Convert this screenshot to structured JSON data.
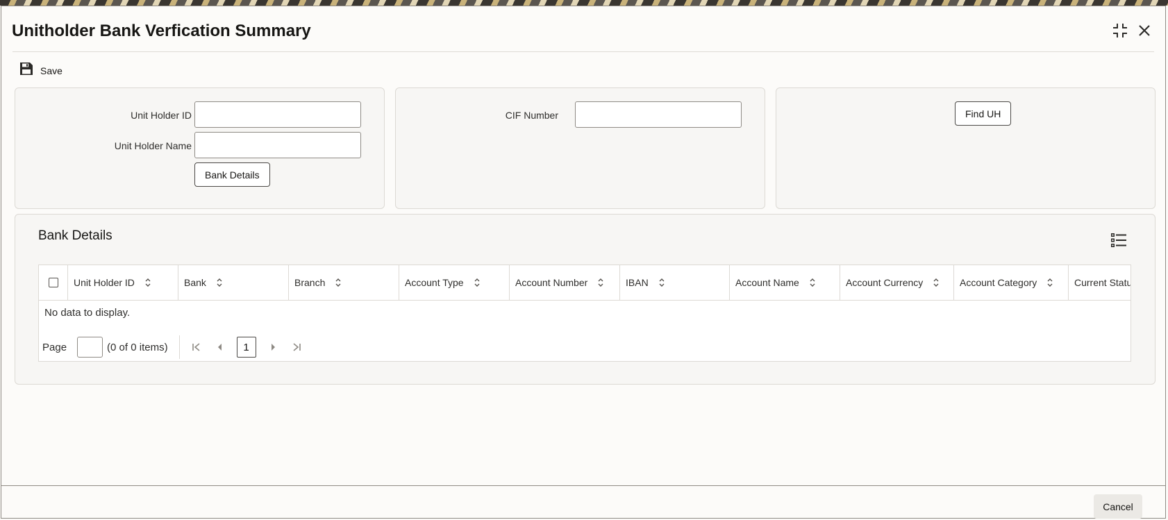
{
  "window": {
    "title": "Unitholder Bank Verfication Summary"
  },
  "toolbar": {
    "save_label": "Save"
  },
  "search": {
    "unit_holder_id_label": "Unit Holder ID",
    "unit_holder_id_value": "",
    "unit_holder_name_label": "Unit Holder Name",
    "unit_holder_name_value": "",
    "bank_details_button": "Bank Details",
    "cif_number_label": "CIF Number",
    "cif_number_value": "",
    "find_uh_button": "Find UH"
  },
  "bank_details": {
    "title": "Bank Details",
    "columns": [
      "Unit Holder ID",
      "Bank",
      "Branch",
      "Account Type",
      "Account Number",
      "IBAN",
      "Account Name",
      "Account Currency",
      "Account Category",
      "Current Status"
    ],
    "empty_text": "No data to display.",
    "pager": {
      "page_label": "Page",
      "page_value": "",
      "count_text": "(0 of 0 items)",
      "current_page": "1"
    }
  },
  "footer": {
    "cancel_label": "Cancel"
  }
}
